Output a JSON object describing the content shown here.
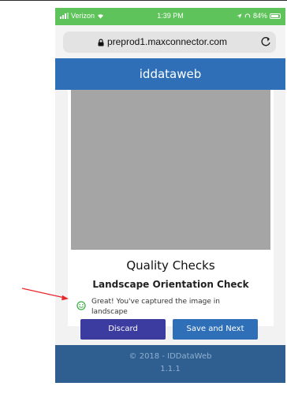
{
  "status_bar": {
    "carrier": "Verizon",
    "time": "1:39 PM",
    "battery": "84%"
  },
  "browser": {
    "url": "preprod1.maxconnector.com"
  },
  "app": {
    "title": "iddataweb"
  },
  "quality": {
    "title": "Quality Checks",
    "check_title": "Landscape Orientation Check",
    "message": "Great! You've captured the image in landscape"
  },
  "buttons": {
    "discard": "Discard",
    "save_next": "Save and Next"
  },
  "footer": {
    "copyright": "© 2018 - IDDataWeb",
    "version": "1.1.1"
  },
  "colors": {
    "status_bar": "#5fc35b",
    "header": "#2e6fb8",
    "discard_button": "#3b3ba0",
    "save_button": "#2e6fb8",
    "footer": "#2f5f90",
    "annotation_arrow": "#e8262a",
    "success_icon": "#3fae49"
  },
  "icons": {
    "lock": "lock-icon",
    "reload": "reload-icon",
    "success": "smiley-icon",
    "annotation": "arrow-icon"
  }
}
